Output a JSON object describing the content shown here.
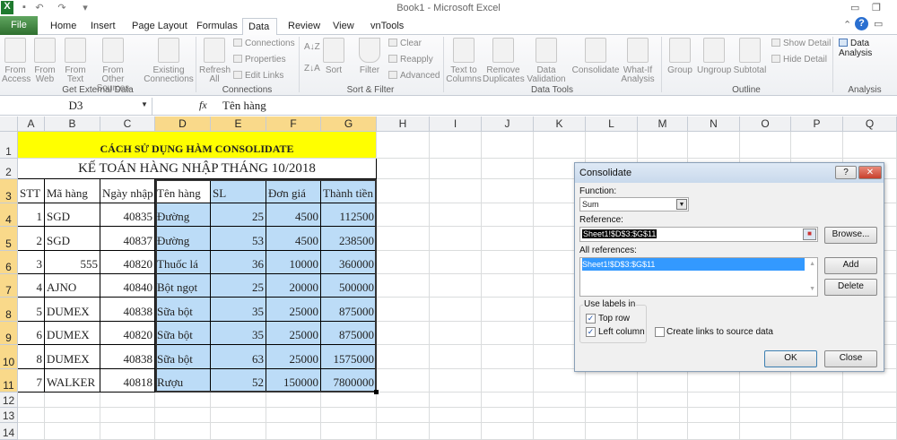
{
  "window": {
    "title": "Book1 - Microsoft Excel",
    "app_icon": "X"
  },
  "tabs": [
    "File",
    "Home",
    "Insert",
    "Page Layout",
    "Formulas",
    "Data",
    "Review",
    "View",
    "vnTools"
  ],
  "ribbon": {
    "get_external": {
      "group": "Get External Data",
      "items": [
        "From Access",
        "From Web",
        "From Text",
        "From Other Sources",
        "Existing Connections"
      ]
    },
    "connections": {
      "group": "Connections",
      "refresh": "Refresh All",
      "small": [
        "Connections",
        "Properties",
        "Edit Links"
      ]
    },
    "sort_filter": {
      "group": "Sort & Filter",
      "sort": "Sort",
      "filter": "Filter",
      "small": [
        "Clear",
        "Reapply",
        "Advanced"
      ]
    },
    "data_tools": {
      "group": "Data Tools",
      "items": [
        "Text to Columns",
        "Remove Duplicates",
        "Data Validation",
        "Consolidate",
        "What-If Analysis"
      ]
    },
    "outline": {
      "group": "Outline",
      "items": [
        "Group",
        "Ungroup",
        "Subtotal"
      ],
      "small": [
        "Show Detail",
        "Hide Detail"
      ]
    },
    "analysis": {
      "group": "Analysis",
      "item": "Data Analysis"
    }
  },
  "formula_bar": {
    "name_box": "D3",
    "fx": "fx",
    "value": "Tên hàng"
  },
  "sheet": {
    "columns": [
      "A",
      "B",
      "C",
      "D",
      "E",
      "F",
      "G",
      "H",
      "I",
      "J",
      "K",
      "L",
      "M",
      "N",
      "O",
      "P",
      "Q"
    ],
    "rows": [
      "1",
      "2",
      "3",
      "4",
      "5",
      "6",
      "7",
      "8",
      "9",
      "10",
      "11",
      "12",
      "13",
      "14"
    ],
    "title1": "CÁCH SỬ DỤNG HÀM CONSOLIDATE",
    "title2": "KẾ TOÁN HÀNG NHẬP THÁNG 10/2018",
    "headers": [
      "STT",
      "Mã hàng",
      "Ngày nhập",
      "Tên hàng",
      "SL",
      "Đơn giá",
      "Thành tiền"
    ],
    "data": [
      [
        "1",
        "SGD",
        "40835",
        "Đường",
        "25",
        "4500",
        "112500"
      ],
      [
        "2",
        "SGD",
        "40837",
        "Đường",
        "53",
        "4500",
        "238500"
      ],
      [
        "3",
        "555",
        "40820",
        "Thuốc lá",
        "36",
        "10000",
        "360000"
      ],
      [
        "4",
        "AJNO",
        "40840",
        "Bột ngọt",
        "25",
        "20000",
        "500000"
      ],
      [
        "5",
        "DUMEX",
        "40838",
        "Sữa bột",
        "35",
        "25000",
        "875000"
      ],
      [
        "6",
        "DUMEX",
        "40820",
        "Sữa bột",
        "35",
        "25000",
        "875000"
      ],
      [
        "8",
        "DUMEX",
        "40838",
        "Sữa bột",
        "63",
        "25000",
        "1575000"
      ],
      [
        "7",
        "WALKER",
        "40818",
        "Rượu",
        "52",
        "150000",
        "7800000"
      ]
    ],
    "colors": {
      "title_fill": "#ffff00",
      "selection": "#bcdcf7",
      "header_selected": "#f9d98a"
    }
  },
  "dialog": {
    "title": "Consolidate",
    "function_label": "Function:",
    "function_value": "Sum",
    "reference_label": "Reference:",
    "reference_value": "Sheet1!$D$3:$G$11",
    "browse": "Browse...",
    "all_refs_label": "All references:",
    "all_refs": [
      "Sheet1!$D$3:$G$11"
    ],
    "add": "Add",
    "delete": "Delete",
    "use_labels": "Use labels in",
    "top_row": "Top row",
    "top_row_checked": true,
    "left_column": "Left column",
    "left_column_checked": true,
    "create_links": "Create links to source data",
    "create_links_checked": false,
    "ok": "OK",
    "close": "Close",
    "help": "?",
    "x": "✕"
  }
}
